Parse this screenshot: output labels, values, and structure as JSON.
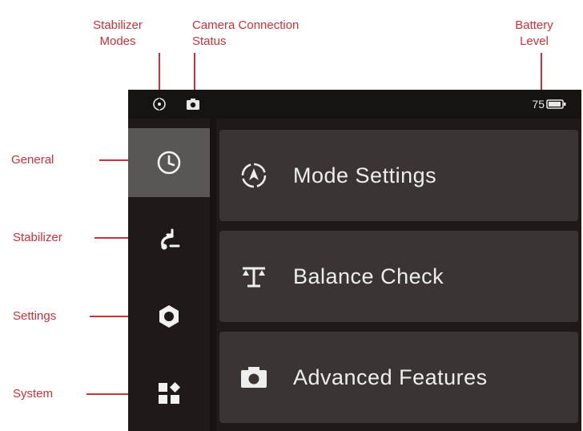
{
  "callouts": {
    "stabilizer_modes": [
      "Stabilizer",
      "Modes"
    ],
    "camera_connection": [
      "Camera Connection",
      "Status"
    ],
    "battery_level": [
      "Battery",
      "Level"
    ],
    "general": "General",
    "stabilizer": "Stabilizer",
    "settings": "Settings",
    "system": "System"
  },
  "status_bar": {
    "stabilizer_mode_icon": "stabilizer-mode-icon",
    "camera_icon": "camera-icon",
    "battery_percent": "75",
    "battery_icon": "battery-icon"
  },
  "sidebar": {
    "items": [
      {
        "id": "general",
        "icon": "clock-icon",
        "active": true
      },
      {
        "id": "stabilizer",
        "icon": "gimbal-icon",
        "active": false
      },
      {
        "id": "settings",
        "icon": "hexagon-icon",
        "active": false
      },
      {
        "id": "system",
        "icon": "apps-icon",
        "active": false
      }
    ]
  },
  "main": {
    "menu": [
      {
        "label": "Mode Settings",
        "icon": "mode-compass-icon"
      },
      {
        "label": "Balance Check",
        "icon": "balance-scale-icon"
      },
      {
        "label": "Advanced Features",
        "icon": "camera-icon"
      }
    ]
  },
  "colors": {
    "callout": "#c8323a",
    "screen_bg": "#1f1a18",
    "panel_bg": "#3a3533",
    "active_tab": "#5a5654"
  }
}
